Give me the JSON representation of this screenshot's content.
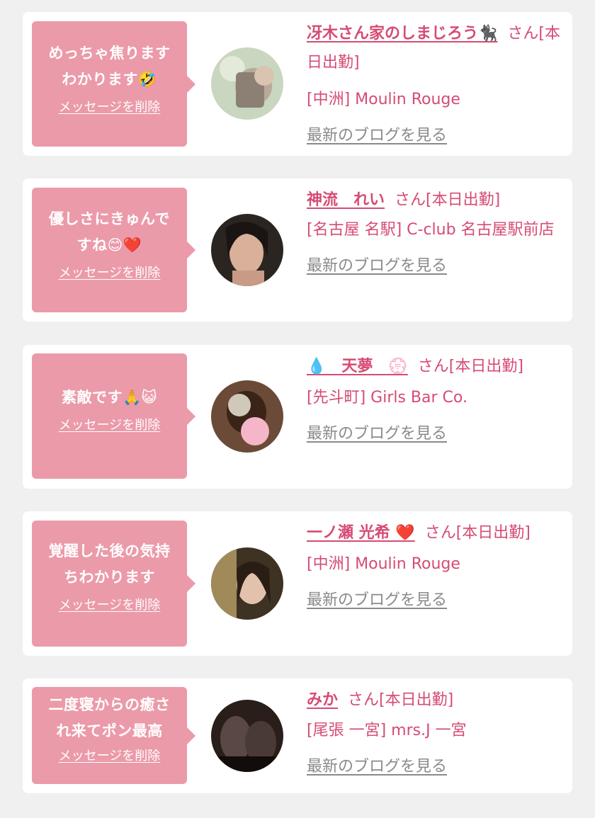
{
  "delete_label": "メッセージを削除",
  "blog_label": "最新のブログを見る",
  "cards": [
    {
      "message": "めっちゃ焦ります わかります🤣",
      "name": "冴木さん家のしまじろう🐈‍⬛",
      "status": "さん[本日出勤]",
      "shop": "[中洲] Moulin Rouge"
    },
    {
      "message": "優しさにきゅんで すね😊❤️",
      "name": "神流　れい",
      "status": "さん[本日出勤]",
      "shop": "[名古屋 名駅] C-club 名古屋駅前店"
    },
    {
      "message": "素敵です🙏😺",
      "name": "💧　天夢　💮",
      "status": "さん[本日出勤]",
      "shop": "[先斗町] Girls Bar Co."
    },
    {
      "message": "覚醒した後の気持 ちわかります",
      "name": "一ノ瀬 光希 ❤️",
      "status": "さん[本日出勤]",
      "shop": "[中洲] Moulin Rouge"
    },
    {
      "message": "二度寝からの癒さ れ来てポン最高",
      "name": "みか",
      "status": "さん[本日出勤]",
      "shop": "[尾張 一宮] mrs.J 一宮"
    }
  ],
  "colors": {
    "bubble": "#eb9aa9",
    "name": "#d64b73",
    "link_gray": "#8a8a8a",
    "background": "#f0f0f0"
  }
}
